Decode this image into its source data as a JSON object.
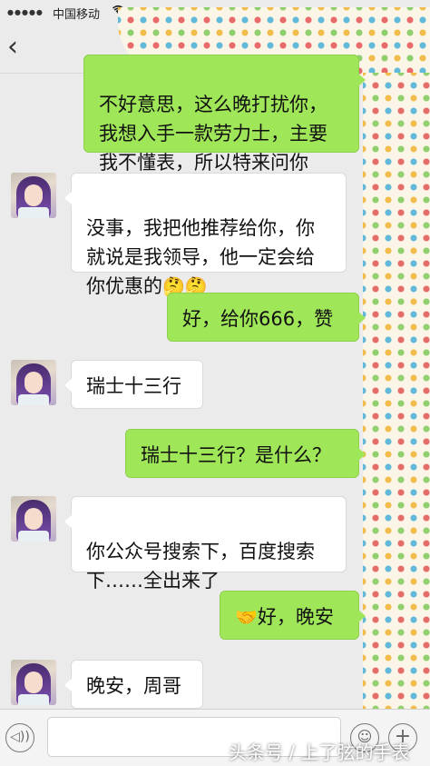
{
  "status_bar": {
    "signal": "●●●●●",
    "carrier": "中国移动",
    "wifi_icon": "wifi-icon"
  },
  "nav": {
    "back_icon": "‹"
  },
  "messages": [
    {
      "side": "right",
      "text": "不好意思，这么晚打扰你，\n我想入手一款劳力士，主要\n我不懂表，所以特来问你"
    },
    {
      "side": "left",
      "text": "没事，我把他推荐给你，你\n就说是我领导，他一定会给\n你优惠的",
      "emoji": "🤔🤔"
    },
    {
      "side": "right",
      "text": "好，给你666，赞"
    },
    {
      "side": "left",
      "text": "瑞士十三行"
    },
    {
      "side": "right",
      "text": "瑞士十三行？是什么？"
    },
    {
      "side": "left",
      "text": "你公众号搜索下，百度搜索\n下……全出来了"
    },
    {
      "side": "right",
      "emoji": "🤝",
      "text": "好，晚安"
    },
    {
      "side": "left",
      "text": "晚安，周哥"
    }
  ],
  "input": {
    "voice_icon": "◁))",
    "emoji_icon": "☺",
    "plus_icon": "+"
  },
  "watermark": "头条号 / 上了弦的手表",
  "colors": {
    "bubble_self": "#9fe658",
    "bubble_other": "#ffffff",
    "background": "#ebebeb"
  }
}
